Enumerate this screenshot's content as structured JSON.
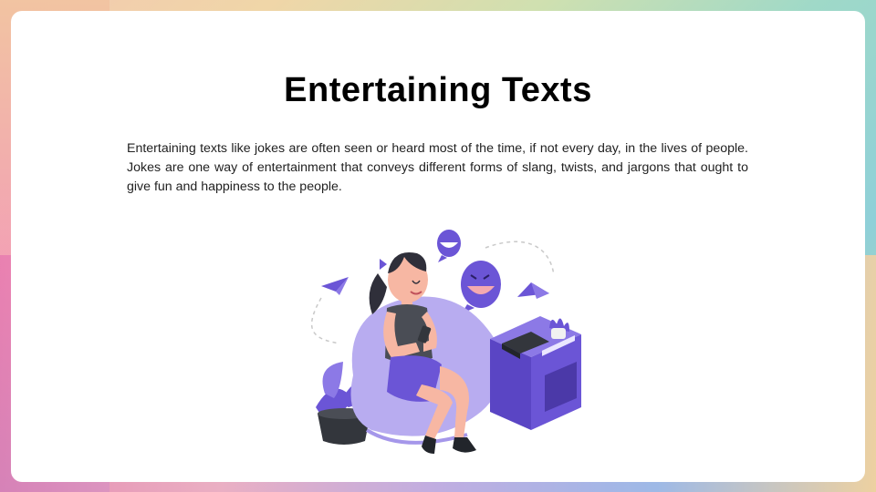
{
  "slide": {
    "title": "Entertaining Texts",
    "body": "Entertaining texts like jokes are often seen or heard most of the time, if not every day, in the lives of people. Jokes are one way of entertainment that conveys different forms of slang, twists, and jargons that ought to give fun and happiness to the people."
  },
  "colors": {
    "accent": "#6b55d6",
    "accent_light": "#b8acf0",
    "skin": "#f7b7a3",
    "dark": "#2f2f3a"
  }
}
